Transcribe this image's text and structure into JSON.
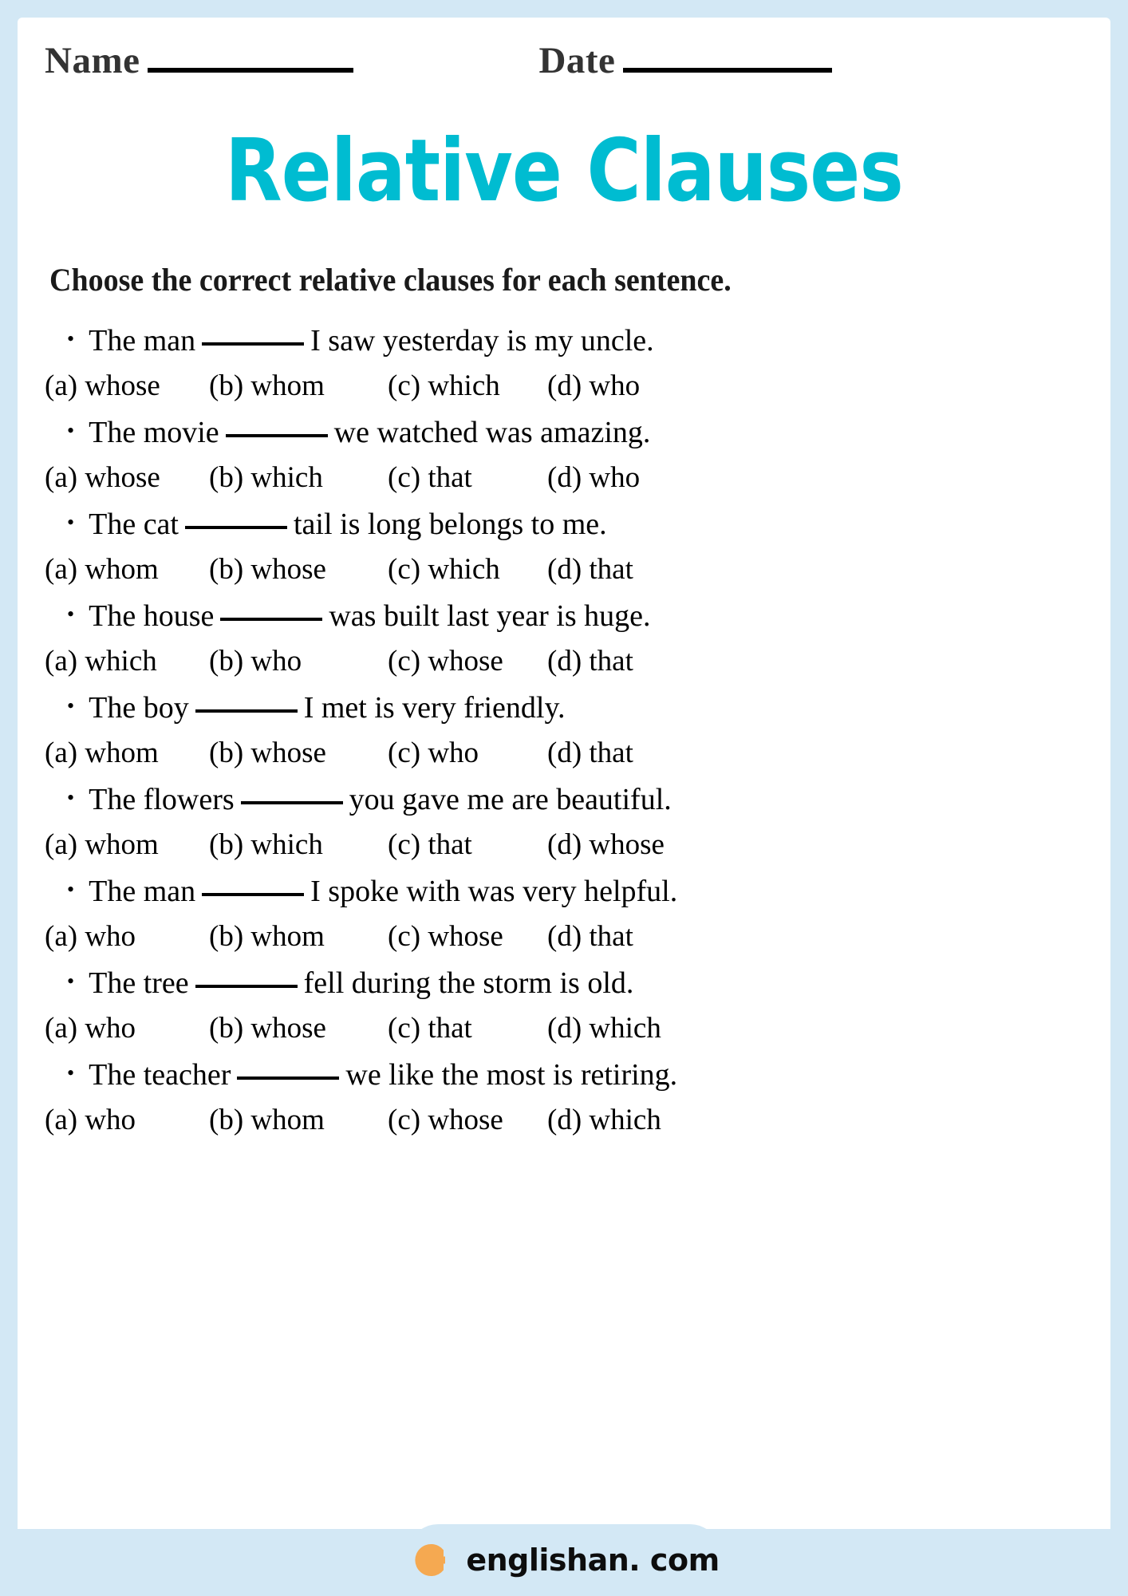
{
  "page": {
    "border_color": "#d3e8f5",
    "sheet_color": "#ffffff"
  },
  "header": {
    "name_label": "Name",
    "date_label": "Date"
  },
  "title": {
    "text": "Relative Clauses",
    "color": "#00bcd1"
  },
  "instruction": {
    "text": "Choose the correct relative clauses for each sentence."
  },
  "questions": [
    {
      "bullet": "•",
      "before": "The man",
      "after": "I saw yesterday is my uncle.",
      "options": [
        "(a) whose",
        "(b) whom",
        "(c) which",
        "(d) who"
      ]
    },
    {
      "bullet": "•",
      "before": "The movie",
      "after": "we watched was amazing.",
      "options": [
        "(a) whose",
        "(b) which",
        "(c) that",
        "(d) who"
      ]
    },
    {
      "bullet": "•",
      "before": "The cat",
      "after": "tail is long belongs to me.",
      "options": [
        "(a) whom",
        "(b) whose",
        "(c) which",
        "(d) that"
      ]
    },
    {
      "bullet": "•",
      "before": "The house",
      "after": "was built last year is huge.",
      "options": [
        "(a) which",
        "(b) who",
        "(c) whose",
        "(d) that"
      ]
    },
    {
      "bullet": "•",
      "before": "The boy",
      "after": "I met is very friendly.",
      "options": [
        "(a) whom",
        "(b) whose",
        "(c) who",
        "(d) that"
      ]
    },
    {
      "bullet": "•",
      "before": "The flowers",
      "after": "you gave me are beautiful.",
      "options": [
        "(a) whom",
        "(b) which",
        "(c) that",
        "(d) whose"
      ]
    },
    {
      "bullet": "•",
      "before": "The man",
      "after": "I spoke with was very helpful.",
      "options": [
        "(a) who",
        "(b) whom",
        "(c) whose",
        "(d) that"
      ]
    },
    {
      "bullet": "•",
      "before": "The tree",
      "after": "fell during the storm is old.",
      "options": [
        "(a) who",
        "(b) whose",
        "(c) that",
        "(d) which"
      ]
    },
    {
      "bullet": "•",
      "before": "The teacher",
      "after": "we like the most is retiring.",
      "options": [
        "(a) who",
        "(b) whom",
        "(c) whose",
        "(d) which"
      ]
    }
  ],
  "footer": {
    "brand_text": "englishan. com",
    "logo_color": "#f5a951",
    "band_color": "#d3e8f5"
  }
}
